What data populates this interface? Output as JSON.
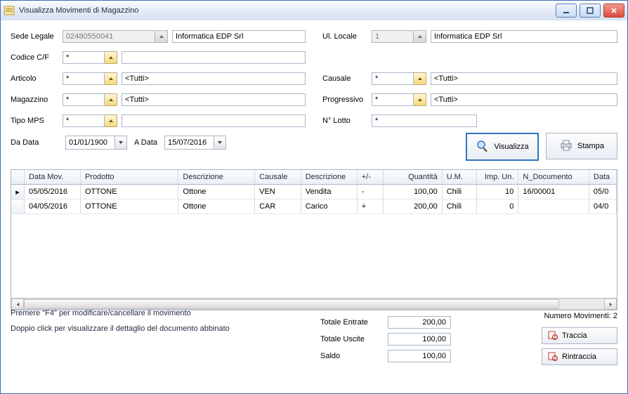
{
  "window": {
    "title": "Visualizza Movimenti di Magazzino"
  },
  "form": {
    "sede_legale": {
      "label": "Sede Legale",
      "code": "02480550041",
      "desc": "Informatica EDP Srl"
    },
    "ul_locale": {
      "label": "Ul. Locale",
      "code": "1",
      "desc": "Informatica EDP Srl"
    },
    "codice_cf": {
      "label": "Codice C/F",
      "code": "*",
      "desc": ""
    },
    "articolo": {
      "label": "Articolo",
      "code": "*",
      "desc": "<Tutti>"
    },
    "causale": {
      "label": "Causale",
      "code": "*",
      "desc": "<Tutti>"
    },
    "magazzino": {
      "label": "Magazzino",
      "code": "*",
      "desc": "<Tutti>"
    },
    "progressivo": {
      "label": "Progressivo",
      "code": "*",
      "desc": "<Tutti>"
    },
    "tipo_mps": {
      "label": "Tipo MPS",
      "code": "*",
      "desc": ""
    },
    "n_lotto": {
      "label": "N° Lotto",
      "value": "*"
    },
    "da_data": {
      "label": "Da Data",
      "value": "01/01/1900"
    },
    "a_data": {
      "label": "A Data",
      "value": "15/07/2016"
    }
  },
  "actions": {
    "visualizza": "Visualizza",
    "stampa": "Stampa",
    "traccia": "Traccia",
    "rintraccia": "Rintraccia"
  },
  "grid": {
    "headers": {
      "data_mov": "Data Mov.",
      "prodotto": "Prodotto",
      "descrizione": "Descrizione",
      "causale": "Causale",
      "descr_causale": "Descrizione",
      "segno": "+/-",
      "quantita": "Quantità",
      "um": "U.M.",
      "imp_un": "Imp. Un.",
      "n_documento": "N_Documento",
      "data_doc": "Data"
    },
    "rows": [
      {
        "data_mov": "05/05/2016",
        "prodotto": "OTTONE",
        "descrizione": "Ottone",
        "causale": "VEN",
        "descr_causale": "Vendita",
        "segno": "-",
        "quantita": "100,00",
        "um": "Chili",
        "imp_un": "10",
        "n_documento": "16/00001",
        "data_doc": "05/0"
      },
      {
        "data_mov": "04/05/2016",
        "prodotto": "OTTONE",
        "descrizione": "Ottone",
        "causale": "CAR",
        "descr_causale": "Carico",
        "segno": "+",
        "quantita": "200,00",
        "um": "Chili",
        "imp_un": "0",
        "n_documento": "",
        "data_doc": "04/0"
      }
    ]
  },
  "hints": {
    "line1": "Premere \"F4\" per modificare/cancellare il movimento",
    "line2": "Doppio click per visualizzare il dettaglio del documento abbinato"
  },
  "totals": {
    "entrate": {
      "label": "Totale Entrate",
      "value": "200,00"
    },
    "uscite": {
      "label": "Totale Uscite",
      "value": "100,00"
    },
    "saldo": {
      "label": "Saldo",
      "value": "100,00"
    }
  },
  "count": {
    "label": "Numero Movimenti:",
    "value": "2"
  }
}
